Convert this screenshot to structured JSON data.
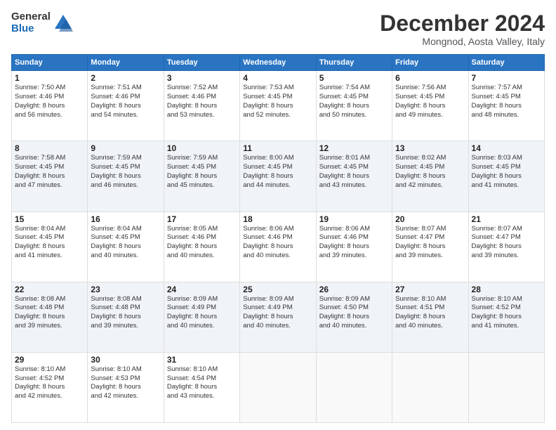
{
  "logo": {
    "general": "General",
    "blue": "Blue"
  },
  "title": {
    "month": "December 2024",
    "location": "Mongnod, Aosta Valley, Italy"
  },
  "header_days": [
    "Sunday",
    "Monday",
    "Tuesday",
    "Wednesday",
    "Thursday",
    "Friday",
    "Saturday"
  ],
  "weeks": [
    [
      {
        "day": "1",
        "lines": [
          "Sunrise: 7:50 AM",
          "Sunset: 4:46 PM",
          "Daylight: 8 hours",
          "and 56 minutes."
        ]
      },
      {
        "day": "2",
        "lines": [
          "Sunrise: 7:51 AM",
          "Sunset: 4:46 PM",
          "Daylight: 8 hours",
          "and 54 minutes."
        ]
      },
      {
        "day": "3",
        "lines": [
          "Sunrise: 7:52 AM",
          "Sunset: 4:46 PM",
          "Daylight: 8 hours",
          "and 53 minutes."
        ]
      },
      {
        "day": "4",
        "lines": [
          "Sunrise: 7:53 AM",
          "Sunset: 4:45 PM",
          "Daylight: 8 hours",
          "and 52 minutes."
        ]
      },
      {
        "day": "5",
        "lines": [
          "Sunrise: 7:54 AM",
          "Sunset: 4:45 PM",
          "Daylight: 8 hours",
          "and 50 minutes."
        ]
      },
      {
        "day": "6",
        "lines": [
          "Sunrise: 7:56 AM",
          "Sunset: 4:45 PM",
          "Daylight: 8 hours",
          "and 49 minutes."
        ]
      },
      {
        "day": "7",
        "lines": [
          "Sunrise: 7:57 AM",
          "Sunset: 4:45 PM",
          "Daylight: 8 hours",
          "and 48 minutes."
        ]
      }
    ],
    [
      {
        "day": "8",
        "lines": [
          "Sunrise: 7:58 AM",
          "Sunset: 4:45 PM",
          "Daylight: 8 hours",
          "and 47 minutes."
        ]
      },
      {
        "day": "9",
        "lines": [
          "Sunrise: 7:59 AM",
          "Sunset: 4:45 PM",
          "Daylight: 8 hours",
          "and 46 minutes."
        ]
      },
      {
        "day": "10",
        "lines": [
          "Sunrise: 7:59 AM",
          "Sunset: 4:45 PM",
          "Daylight: 8 hours",
          "and 45 minutes."
        ]
      },
      {
        "day": "11",
        "lines": [
          "Sunrise: 8:00 AM",
          "Sunset: 4:45 PM",
          "Daylight: 8 hours",
          "and 44 minutes."
        ]
      },
      {
        "day": "12",
        "lines": [
          "Sunrise: 8:01 AM",
          "Sunset: 4:45 PM",
          "Daylight: 8 hours",
          "and 43 minutes."
        ]
      },
      {
        "day": "13",
        "lines": [
          "Sunrise: 8:02 AM",
          "Sunset: 4:45 PM",
          "Daylight: 8 hours",
          "and 42 minutes."
        ]
      },
      {
        "day": "14",
        "lines": [
          "Sunrise: 8:03 AM",
          "Sunset: 4:45 PM",
          "Daylight: 8 hours",
          "and 41 minutes."
        ]
      }
    ],
    [
      {
        "day": "15",
        "lines": [
          "Sunrise: 8:04 AM",
          "Sunset: 4:45 PM",
          "Daylight: 8 hours",
          "and 41 minutes."
        ]
      },
      {
        "day": "16",
        "lines": [
          "Sunrise: 8:04 AM",
          "Sunset: 4:45 PM",
          "Daylight: 8 hours",
          "and 40 minutes."
        ]
      },
      {
        "day": "17",
        "lines": [
          "Sunrise: 8:05 AM",
          "Sunset: 4:46 PM",
          "Daylight: 8 hours",
          "and 40 minutes."
        ]
      },
      {
        "day": "18",
        "lines": [
          "Sunrise: 8:06 AM",
          "Sunset: 4:46 PM",
          "Daylight: 8 hours",
          "and 40 minutes."
        ]
      },
      {
        "day": "19",
        "lines": [
          "Sunrise: 8:06 AM",
          "Sunset: 4:46 PM",
          "Daylight: 8 hours",
          "and 39 minutes."
        ]
      },
      {
        "day": "20",
        "lines": [
          "Sunrise: 8:07 AM",
          "Sunset: 4:47 PM",
          "Daylight: 8 hours",
          "and 39 minutes."
        ]
      },
      {
        "day": "21",
        "lines": [
          "Sunrise: 8:07 AM",
          "Sunset: 4:47 PM",
          "Daylight: 8 hours",
          "and 39 minutes."
        ]
      }
    ],
    [
      {
        "day": "22",
        "lines": [
          "Sunrise: 8:08 AM",
          "Sunset: 4:48 PM",
          "Daylight: 8 hours",
          "and 39 minutes."
        ]
      },
      {
        "day": "23",
        "lines": [
          "Sunrise: 8:08 AM",
          "Sunset: 4:48 PM",
          "Daylight: 8 hours",
          "and 39 minutes."
        ]
      },
      {
        "day": "24",
        "lines": [
          "Sunrise: 8:09 AM",
          "Sunset: 4:49 PM",
          "Daylight: 8 hours",
          "and 40 minutes."
        ]
      },
      {
        "day": "25",
        "lines": [
          "Sunrise: 8:09 AM",
          "Sunset: 4:49 PM",
          "Daylight: 8 hours",
          "and 40 minutes."
        ]
      },
      {
        "day": "26",
        "lines": [
          "Sunrise: 8:09 AM",
          "Sunset: 4:50 PM",
          "Daylight: 8 hours",
          "and 40 minutes."
        ]
      },
      {
        "day": "27",
        "lines": [
          "Sunrise: 8:10 AM",
          "Sunset: 4:51 PM",
          "Daylight: 8 hours",
          "and 40 minutes."
        ]
      },
      {
        "day": "28",
        "lines": [
          "Sunrise: 8:10 AM",
          "Sunset: 4:52 PM",
          "Daylight: 8 hours",
          "and 41 minutes."
        ]
      }
    ],
    [
      {
        "day": "29",
        "lines": [
          "Sunrise: 8:10 AM",
          "Sunset: 4:52 PM",
          "Daylight: 8 hours",
          "and 42 minutes."
        ]
      },
      {
        "day": "30",
        "lines": [
          "Sunrise: 8:10 AM",
          "Sunset: 4:53 PM",
          "Daylight: 8 hours",
          "and 42 minutes."
        ]
      },
      {
        "day": "31",
        "lines": [
          "Sunrise: 8:10 AM",
          "Sunset: 4:54 PM",
          "Daylight: 8 hours",
          "and 43 minutes."
        ]
      },
      null,
      null,
      null,
      null
    ]
  ]
}
